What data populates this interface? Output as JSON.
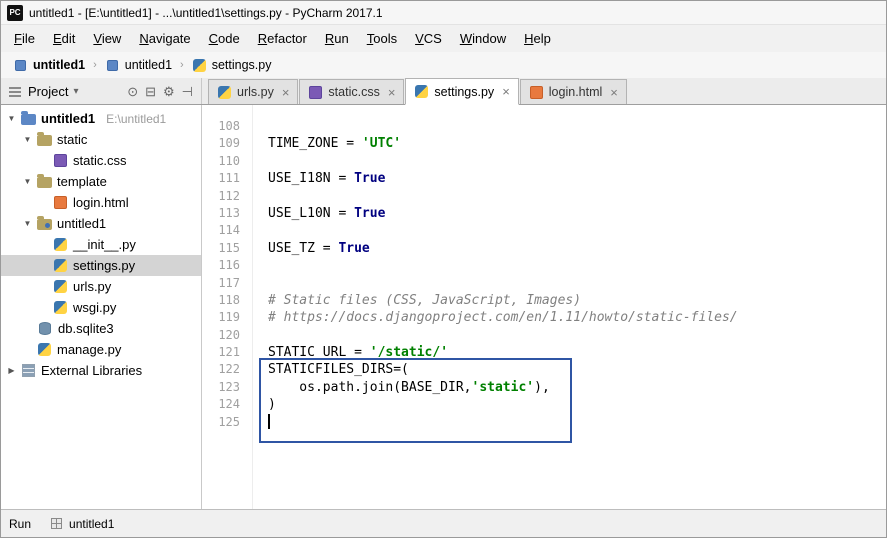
{
  "window": {
    "icon_text": "PC",
    "title": "untitled1 - [E:\\untitled1] - ...\\untitled1\\settings.py - PyCharm 2017.1"
  },
  "menu": {
    "items": [
      "File",
      "Edit",
      "View",
      "Navigate",
      "Code",
      "Refactor",
      "Run",
      "Tools",
      "VCS",
      "Window",
      "Help"
    ]
  },
  "breadcrumb": {
    "items": [
      {
        "label": "untitled1",
        "icon": "module",
        "bold": true
      },
      {
        "label": "untitled1",
        "icon": "module",
        "bold": false
      },
      {
        "label": "settings.py",
        "icon": "python-file",
        "bold": false
      }
    ]
  },
  "project_panel": {
    "title": "Project",
    "toolbar_icons": [
      "locate",
      "collapse-all",
      "settings",
      "hide"
    ]
  },
  "tabs": {
    "items": [
      {
        "label": "urls.py",
        "icon": "python-file",
        "active": false
      },
      {
        "label": "static.css",
        "icon": "css-file",
        "active": false
      },
      {
        "label": "settings.py",
        "icon": "python-file",
        "active": true
      },
      {
        "label": "login.html",
        "icon": "html-file",
        "active": false
      }
    ]
  },
  "tree": {
    "items": [
      {
        "label": "untitled1",
        "annotation": "E:\\untitled1",
        "depth": 0,
        "icon": "project-folder",
        "state": "expanded",
        "bold": true
      },
      {
        "label": "static",
        "depth": 1,
        "icon": "folder",
        "state": "expanded"
      },
      {
        "label": "static.css",
        "depth": 2,
        "icon": "css-file"
      },
      {
        "label": "template",
        "depth": 1,
        "icon": "folder",
        "state": "expanded"
      },
      {
        "label": "login.html",
        "depth": 2,
        "icon": "html-file"
      },
      {
        "label": "untitled1",
        "depth": 1,
        "icon": "package",
        "state": "expanded"
      },
      {
        "label": "__init__.py",
        "depth": 2,
        "icon": "python-file"
      },
      {
        "label": "settings.py",
        "depth": 2,
        "icon": "python-file",
        "selected": true
      },
      {
        "label": "urls.py",
        "depth": 2,
        "icon": "python-file"
      },
      {
        "label": "wsgi.py",
        "depth": 2,
        "icon": "python-file"
      },
      {
        "label": "db.sqlite3",
        "depth": 1,
        "icon": "database-file"
      },
      {
        "label": "manage.py",
        "depth": 1,
        "icon": "python-file"
      },
      {
        "label": "External Libraries",
        "depth": 0,
        "icon": "libraries",
        "state": "collapsed"
      }
    ]
  },
  "editor": {
    "syntax_colors": {
      "plain": "#000000",
      "string": "#008000",
      "keyword": "#000080",
      "comment": "#808080"
    },
    "highlight_box_color": "#2f55a4",
    "lines": [
      {
        "number": 108,
        "segments": []
      },
      {
        "number": 109,
        "segments": [
          {
            "type": "plain",
            "text": "TIME_ZONE = "
          },
          {
            "type": "string",
            "text": "'UTC'"
          }
        ]
      },
      {
        "number": 110,
        "segments": []
      },
      {
        "number": 111,
        "segments": [
          {
            "type": "plain",
            "text": "USE_I18N = "
          },
          {
            "type": "keyword",
            "text": "True"
          }
        ]
      },
      {
        "number": 112,
        "segments": []
      },
      {
        "number": 113,
        "segments": [
          {
            "type": "plain",
            "text": "USE_L10N = "
          },
          {
            "type": "keyword",
            "text": "True"
          }
        ]
      },
      {
        "number": 114,
        "segments": []
      },
      {
        "number": 115,
        "segments": [
          {
            "type": "plain",
            "text": "USE_TZ = "
          },
          {
            "type": "keyword",
            "text": "True"
          }
        ]
      },
      {
        "number": 116,
        "segments": []
      },
      {
        "number": 117,
        "segments": []
      },
      {
        "number": 118,
        "segments": [
          {
            "type": "comment",
            "text": "# Static files (CSS, JavaScript, Images)"
          }
        ]
      },
      {
        "number": 119,
        "segments": [
          {
            "type": "comment",
            "text": "# https://docs.djangoproject.com/en/1.11/howto/static-files/"
          }
        ]
      },
      {
        "number": 120,
        "segments": []
      },
      {
        "number": 121,
        "segments": [
          {
            "type": "plain",
            "text": "STATIC_URL = "
          },
          {
            "type": "string",
            "text": "'/static/'"
          }
        ]
      },
      {
        "number": 122,
        "segments": [
          {
            "type": "plain",
            "text": "STATICFILES_DIRS=("
          }
        ]
      },
      {
        "number": 123,
        "segments": [
          {
            "type": "plain",
            "text": "    os.path.join(BASE_DIR,"
          },
          {
            "type": "string",
            "text": "'static'"
          },
          {
            "type": "plain",
            "text": "),"
          }
        ]
      },
      {
        "number": 124,
        "segments": [
          {
            "type": "plain",
            "text": ")"
          }
        ]
      },
      {
        "number": 125,
        "segments": [],
        "cursor": true
      }
    ]
  },
  "status_bar": {
    "run_label": "Run",
    "tab_label": "untitled1"
  }
}
